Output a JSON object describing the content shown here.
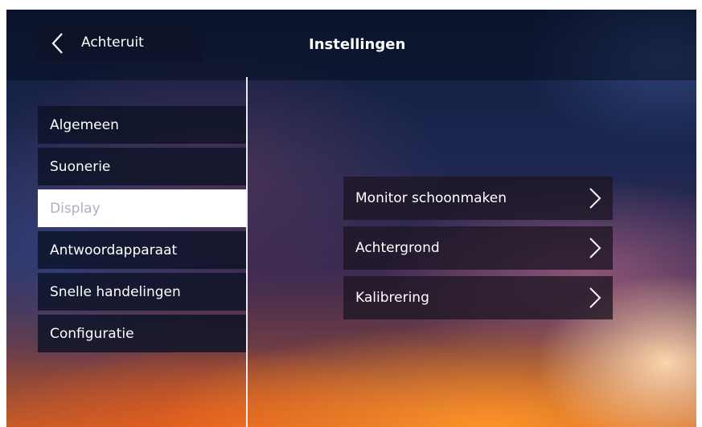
{
  "header": {
    "back_label": "Achteruit",
    "title": "Instellingen"
  },
  "sidebar": {
    "items": [
      {
        "label": "Algemeen"
      },
      {
        "label": "Suonerie"
      },
      {
        "label": "Display",
        "selected": true
      },
      {
        "label": "Antwoordapparaat"
      },
      {
        "label": "Snelle handelingen"
      },
      {
        "label": "Configuratie"
      }
    ]
  },
  "display_menu": {
    "items": [
      {
        "label": "Monitor schoonmaken",
        "icon": "chevron-right-icon"
      },
      {
        "label": "Achtergrond",
        "icon": "chevron-right-icon"
      },
      {
        "label": "Kalibrering",
        "icon": "chevron-right-icon"
      }
    ]
  },
  "colors": {
    "selected_item_background": "#ffffff",
    "selected_item_text": "#aab0bd",
    "item_text": "#ffffff"
  }
}
